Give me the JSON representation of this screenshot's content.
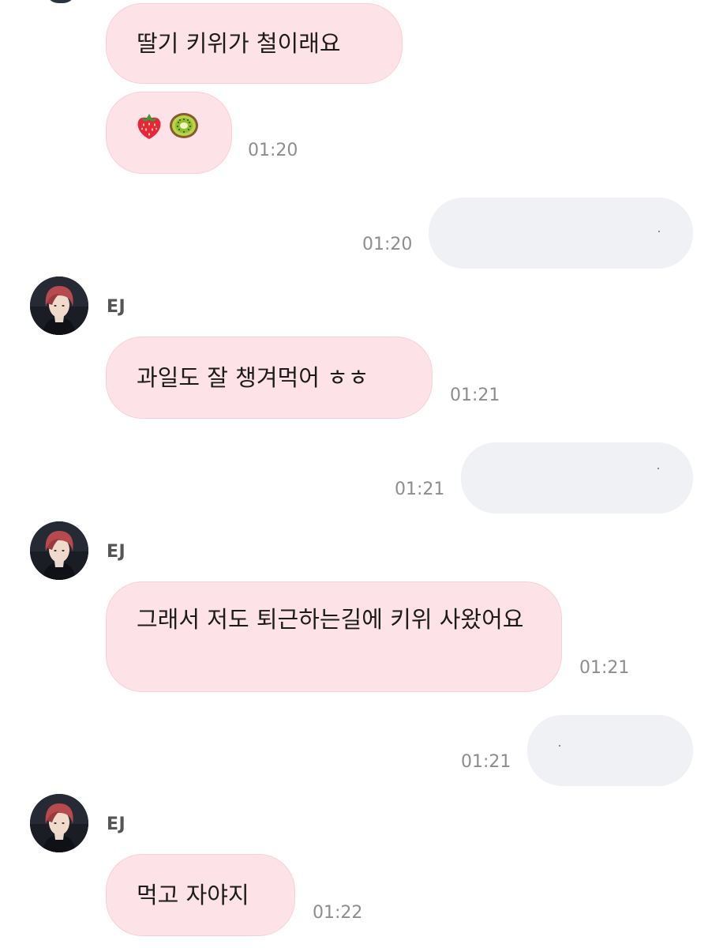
{
  "messages": [
    {
      "sender": "EJ",
      "text": "딸기 키위가 철이래요"
    },
    {
      "sender": "EJ",
      "emojis": [
        "strawberry",
        "kiwi"
      ],
      "time": "01:20"
    },
    {
      "sender": "me",
      "time": "01:20"
    },
    {
      "sender": "EJ",
      "name": "EJ",
      "text": "과일도 잘 챙겨먹어 ㅎㅎ",
      "time": "01:21"
    },
    {
      "sender": "me",
      "time": "01:21"
    },
    {
      "sender": "EJ",
      "name": "EJ",
      "text": "그래서 저도 퇴근하는길에 키위 사왔어요",
      "time": "01:21"
    },
    {
      "sender": "me",
      "time": "01:21"
    },
    {
      "sender": "EJ",
      "name": "EJ",
      "text": "먹고 자야지",
      "time": "01:22"
    }
  ],
  "colors": {
    "incoming_bubble": "#fde3e7",
    "outgoing_bubble": "#f0f1f5",
    "timestamp": "#8d8d8d"
  }
}
